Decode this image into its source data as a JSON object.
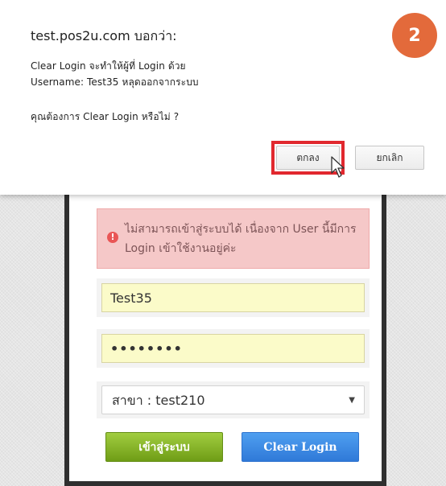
{
  "dialog": {
    "title": "test.pos2u.com บอกว่า:",
    "line1": "Clear Login จะทำให้ผู้ที่ Login ด้วย",
    "line2": "Username: Test35  หลุดออกจากระบบ",
    "question": "คุณต้องการ Clear Login หรือไม่ ?",
    "ok_label": "ตกลง",
    "cancel_label": "ยกเลิก"
  },
  "step_badge": "2",
  "login": {
    "error_message": "ไม่สามารถเข้าสู่ระบบได้ เนื่องจาก User นี้มีการ Login เข้าใช้งานอยู่ค่ะ",
    "username_value": "Test35",
    "password_value": "••••••••",
    "branch_selected": "สาขา : test210",
    "login_button_label": "เข้าสู่ระบบ",
    "clear_login_label": "Clear Login"
  },
  "colors": {
    "badge": "#e36a3b",
    "highlight": "#e1282e",
    "error_bg": "#f5c8c8",
    "input_bg": "#fbfbc9",
    "login_green": "#8bbd2d",
    "clear_blue": "#3b88e4"
  },
  "icons": {
    "error": "exclamation-circle-icon",
    "select": "caret-down-icon",
    "cursor": "mouse-pointer-icon"
  }
}
